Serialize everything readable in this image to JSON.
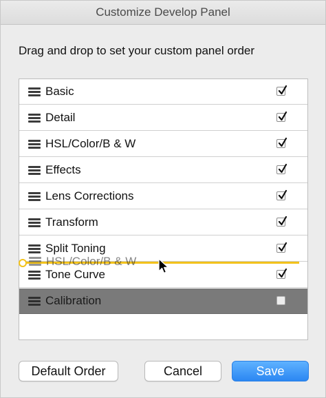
{
  "window": {
    "title": "Customize Develop Panel"
  },
  "instruction": "Drag and drop to set your custom panel order",
  "panels": [
    {
      "label": "Basic",
      "checked": true
    },
    {
      "label": "Detail",
      "checked": true
    },
    {
      "label": "HSL/Color/B & W",
      "checked": true
    },
    {
      "label": "Effects",
      "checked": true
    },
    {
      "label": "Lens Corrections",
      "checked": true
    },
    {
      "label": "Transform",
      "checked": true
    },
    {
      "label": "Split Toning",
      "checked": true
    },
    {
      "label": "Tone Curve",
      "checked": true
    },
    {
      "label": "Calibration",
      "checked": false,
      "selected": true
    }
  ],
  "drag": {
    "ghost_label": "HSL/Color/B & W"
  },
  "buttons": {
    "default_order": "Default Order",
    "cancel": "Cancel",
    "save": "Save"
  },
  "colors": {
    "accent": "#2b87f2",
    "drop_indicator": "#f2c21b",
    "selected_row": "#7a7a7a"
  }
}
